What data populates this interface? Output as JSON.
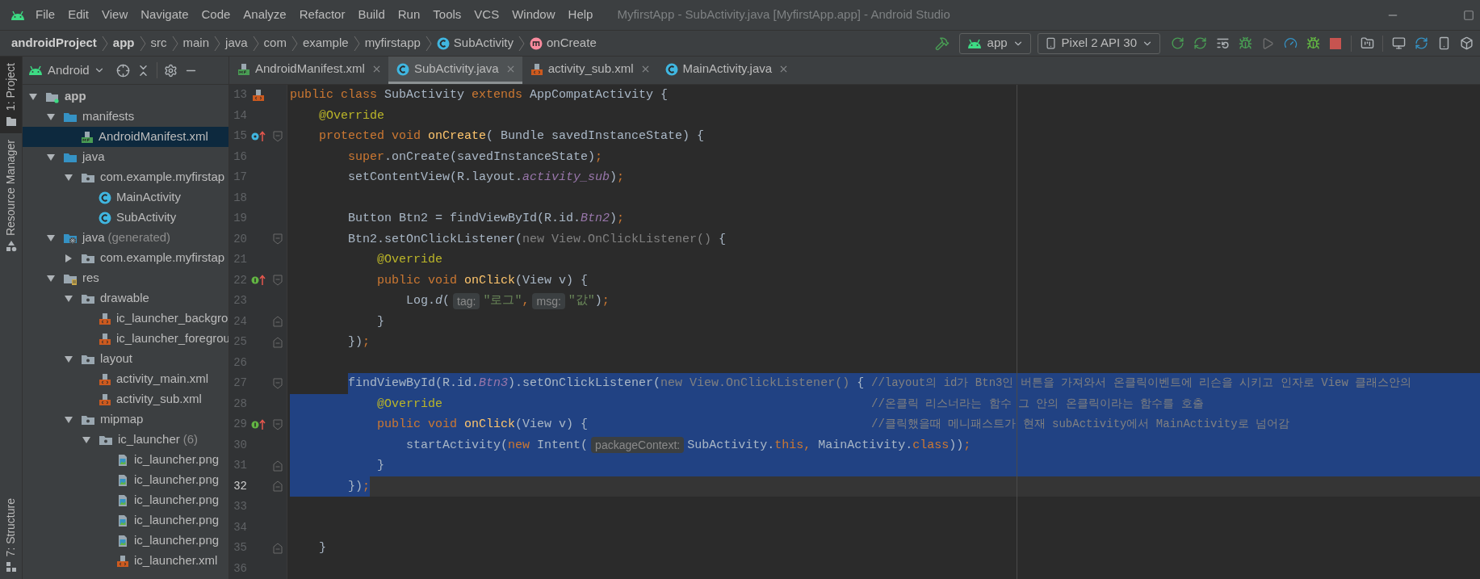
{
  "menu": {
    "items": [
      "File",
      "Edit",
      "View",
      "Navigate",
      "Code",
      "Analyze",
      "Refactor",
      "Build",
      "Run",
      "Tools",
      "VCS",
      "Window",
      "Help"
    ],
    "title": "MyfirstApp - SubActivity.java [MyfirstApp.app] - Android Studio"
  },
  "nav": {
    "breadcrumbs": [
      {
        "label": "androidProject",
        "kind": "project"
      },
      {
        "label": "app",
        "kind": "module"
      },
      {
        "label": "src",
        "kind": "folder"
      },
      {
        "label": "main",
        "kind": "folder"
      },
      {
        "label": "java",
        "kind": "folder"
      },
      {
        "label": "com",
        "kind": "folder"
      },
      {
        "label": "example",
        "kind": "folder"
      },
      {
        "label": "myfirstapp",
        "kind": "folder"
      },
      {
        "label": "SubActivity",
        "kind": "class"
      },
      {
        "label": "onCreate",
        "kind": "method"
      }
    ],
    "run_config": "app",
    "device": "Pixel 2 API 30"
  },
  "side_strip": [
    {
      "label": "1: Project",
      "selected": true
    },
    {
      "label": "Resource Manager",
      "selected": false
    },
    {
      "label": "7: Structure",
      "selected": false
    }
  ],
  "project_view": {
    "mode": "Android"
  },
  "tabs": [
    {
      "label": "AndroidManifest.xml",
      "kind": "manifest",
      "selected": false
    },
    {
      "label": "SubActivity.java",
      "kind": "class",
      "selected": true
    },
    {
      "label": "activity_sub.xml",
      "kind": "xml",
      "selected": false
    },
    {
      "label": "MainActivity.java",
      "kind": "class",
      "selected": false
    }
  ],
  "tree": [
    {
      "label": "app",
      "kind": "module",
      "expanded": true,
      "selected": false,
      "children": [
        {
          "label": "manifests",
          "kind": "folder",
          "expanded": true,
          "selected": false,
          "children": [
            {
              "label": "AndroidManifest.xml",
              "kind": "manifest",
              "selected": true
            }
          ]
        },
        {
          "label": "java",
          "kind": "folder",
          "expanded": true,
          "selected": false,
          "children": [
            {
              "label": "com.example.myfirstap",
              "kind": "package",
              "expanded": true,
              "selected": false,
              "children": [
                {
                  "label": "MainActivity",
                  "kind": "class",
                  "selected": false
                },
                {
                  "label": "SubActivity",
                  "kind": "class",
                  "selected": false
                }
              ]
            }
          ]
        },
        {
          "label": "java",
          "note": "(generated)",
          "kind": "generated",
          "expanded": true,
          "selected": false,
          "children": [
            {
              "label": "com.example.myfirstap",
              "kind": "package",
              "expanded": false,
              "selected": false
            }
          ]
        },
        {
          "label": "res",
          "kind": "res",
          "expanded": true,
          "selected": false,
          "children": [
            {
              "label": "drawable",
              "kind": "package",
              "expanded": true,
              "selected": false,
              "children": [
                {
                  "label": "ic_launcher_backgro",
                  "kind": "xml",
                  "selected": false
                },
                {
                  "label": "ic_launcher_foregrou",
                  "kind": "xml",
                  "selected": false
                }
              ]
            },
            {
              "label": "layout",
              "kind": "package",
              "expanded": true,
              "selected": false,
              "children": [
                {
                  "label": "activity_main.xml",
                  "kind": "xml",
                  "selected": false
                },
                {
                  "label": "activity_sub.xml",
                  "kind": "xml",
                  "selected": false
                }
              ]
            },
            {
              "label": "mipmap",
              "kind": "package",
              "expanded": true,
              "selected": false,
              "children": [
                {
                  "label": "ic_launcher",
                  "note": "(6)",
                  "kind": "package",
                  "expanded": true,
                  "selected": false,
                  "children": [
                    {
                      "label": "ic_launcher.png",
                      "kind": "png",
                      "selected": false
                    },
                    {
                      "label": "ic_launcher.png",
                      "kind": "png",
                      "selected": false
                    },
                    {
                      "label": "ic_launcher.png",
                      "kind": "png",
                      "selected": false
                    },
                    {
                      "label": "ic_launcher.png",
                      "kind": "png",
                      "selected": false
                    },
                    {
                      "label": "ic_launcher.png",
                      "kind": "png",
                      "selected": false
                    },
                    {
                      "label": "ic_launcher.xml",
                      "kind": "xml",
                      "selected": false
                    }
                  ]
                }
              ]
            }
          ]
        }
      ]
    }
  ],
  "editor": {
    "lines": [
      {
        "number": "13",
        "gutter_icons": [
          {
            "kind": "xml"
          }
        ],
        "selected": false,
        "current": false,
        "tokens": [
          {
            "t": "public class ",
            "kind": "kw"
          },
          {
            "t": "SubActivity ",
            "kind": "plain"
          },
          {
            "t": "extends ",
            "kind": "kw"
          },
          {
            "t": "AppCompatActivity {",
            "kind": "plain"
          }
        ]
      },
      {
        "number": "14",
        "selected": false,
        "current": false,
        "tokens": [
          {
            "t": "    @Override",
            "kind": "ann"
          }
        ]
      },
      {
        "number": "15",
        "gutter_icons": [
          {
            "kind": "override"
          },
          {
            "kind": "fold_start"
          }
        ],
        "selected": false,
        "current": false,
        "tokens": [
          {
            "t": "    protected void ",
            "kind": "kw"
          },
          {
            "t": "onCreate",
            "kind": "fn"
          },
          {
            "t": "( Bundle savedInstanceState) {",
            "kind": "plain"
          }
        ]
      },
      {
        "number": "16",
        "selected": false,
        "current": false,
        "tokens": [
          {
            "t": "        super",
            "kind": "kw"
          },
          {
            "t": ".onCreate(savedInstanceState)",
            "kind": "plain"
          },
          {
            "t": ";",
            "kind": "kw"
          }
        ]
      },
      {
        "number": "17",
        "selected": false,
        "current": false,
        "tokens": [
          {
            "t": "        setContentView(R.layout.",
            "kind": "plain"
          },
          {
            "t": "activity_sub",
            "kind": "field"
          },
          {
            "t": ")",
            "kind": "plain"
          },
          {
            "t": ";",
            "kind": "kw"
          }
        ]
      },
      {
        "number": "18",
        "selected": false,
        "current": false
      },
      {
        "number": "19",
        "selected": false,
        "current": false,
        "tokens": [
          {
            "t": "        Button Btn2 = findViewById(R.id.",
            "kind": "plain"
          },
          {
            "t": "Btn2",
            "kind": "field"
          },
          {
            "t": ")",
            "kind": "plain"
          },
          {
            "t": ";",
            "kind": "kw"
          }
        ]
      },
      {
        "number": "20",
        "gutter_icons": [
          {
            "kind": "fold_start"
          }
        ],
        "selected": false,
        "current": false,
        "tokens": [
          {
            "t": "        Btn2.setOnClickListener(",
            "kind": "plain"
          },
          {
            "t": "new View.OnClickListener()",
            "kind": "gray"
          },
          {
            "t": " {",
            "kind": "plain"
          }
        ]
      },
      {
        "number": "21",
        "selected": false,
        "current": false,
        "tokens": [
          {
            "t": "            @Override",
            "kind": "ann"
          }
        ]
      },
      {
        "number": "22",
        "gutter_icons": [
          {
            "kind": "implement"
          },
          {
            "kind": "fold_start"
          }
        ],
        "selected": false,
        "current": false,
        "tokens": [
          {
            "t": "            public void ",
            "kind": "kw"
          },
          {
            "t": "onClick",
            "kind": "fn"
          },
          {
            "t": "(View v) {",
            "kind": "plain"
          }
        ]
      },
      {
        "number": "23",
        "selected": false,
        "current": false,
        "tokens": [
          {
            "t": "                Log.",
            "kind": "plain"
          },
          {
            "t": "d",
            "kind": "italic"
          },
          {
            "t": "(",
            "kind": "plain"
          },
          {
            "t": "tag:",
            "kind": "hint"
          },
          {
            "t": "\"로그\"",
            "kind": "str"
          },
          {
            "t": ",",
            "kind": "kw"
          },
          {
            "t": "msg:",
            "kind": "hint"
          },
          {
            "t": "\"값\"",
            "kind": "str"
          },
          {
            "t": ")",
            "kind": "plain"
          },
          {
            "t": ";",
            "kind": "kw"
          }
        ]
      },
      {
        "number": "24",
        "gutter_icons": [
          {
            "kind": "fold_end"
          }
        ],
        "selected": false,
        "current": false,
        "tokens": [
          {
            "t": "            }",
            "kind": "plain"
          }
        ]
      },
      {
        "number": "25",
        "gutter_icons": [
          {
            "kind": "fold_end"
          }
        ],
        "selected": false,
        "current": false,
        "tokens": [
          {
            "t": "        })",
            "kind": "plain"
          },
          {
            "t": ";",
            "kind": "kw"
          }
        ]
      },
      {
        "number": "26",
        "selected": false,
        "current": false
      },
      {
        "number": "27",
        "gutter_icons": [
          {
            "kind": "fold_start"
          }
        ],
        "selected": true,
        "current": false,
        "tokens": [
          {
            "t": "        findViewById(R.id.",
            "kind": "plain"
          },
          {
            "t": "Btn3",
            "kind": "field"
          },
          {
            "t": ").setOnClickListener(",
            "kind": "plain"
          },
          {
            "t": "new View.OnClickListener()",
            "kind": "gray"
          },
          {
            "t": " {",
            "kind": "plain"
          }
        ],
        "comment": "//layout의 id가 Btn3인 버튼을 가져와서 온클릭이벤트에 리슨을 시키고 인자로 View 클래스안의"
      },
      {
        "number": "28",
        "selected": true,
        "current": false,
        "tokens": [
          {
            "t": "            @Override",
            "kind": "ann"
          }
        ],
        "comment": "//온클릭 리스너라는 함수 그 안의 온클릭이라는 함수를 호출"
      },
      {
        "number": "29",
        "gutter_icons": [
          {
            "kind": "implement"
          },
          {
            "kind": "fold_start"
          }
        ],
        "selected": true,
        "current": false,
        "tokens": [
          {
            "t": "            public void ",
            "kind": "kw"
          },
          {
            "t": "onClick",
            "kind": "fn"
          },
          {
            "t": "(View v) {",
            "kind": "plain"
          }
        ],
        "comment": "//클릭했을때 메니패스트가 현재 subActivity에서 MainActivity로 넘어감"
      },
      {
        "number": "30",
        "selected": true,
        "current": false,
        "tokens": [
          {
            "t": "                startActivity(",
            "kind": "plain"
          },
          {
            "t": "new ",
            "kind": "kw"
          },
          {
            "t": "Intent(",
            "kind": "plain"
          },
          {
            "t": "packageContext:",
            "kind": "hint"
          },
          {
            "t": "SubActivity.",
            "kind": "plain"
          },
          {
            "t": "this",
            "kind": "kw"
          },
          {
            "t": ",",
            "kind": "kw"
          },
          {
            "t": " MainActivity.",
            "kind": "plain"
          },
          {
            "t": "class",
            "kind": "kw"
          },
          {
            "t": "))",
            "kind": "plain"
          },
          {
            "t": ";",
            "kind": "kw"
          }
        ]
      },
      {
        "number": "31",
        "gutter_icons": [
          {
            "kind": "fold_end"
          }
        ],
        "selected": true,
        "current": false,
        "tokens": [
          {
            "t": "            }",
            "kind": "plain"
          }
        ]
      },
      {
        "number": "32",
        "gutter_icons": [
          {
            "kind": "fold_end"
          }
        ],
        "selected": true,
        "current": true,
        "tokens": [
          {
            "t": "        })",
            "kind": "plain"
          },
          {
            "t": ";",
            "kind": "kw"
          }
        ]
      },
      {
        "number": "33",
        "selected": false,
        "current": false
      },
      {
        "number": "34",
        "selected": false,
        "current": false
      },
      {
        "number": "35",
        "gutter_icons": [
          {
            "kind": "fold_end"
          }
        ],
        "selected": false,
        "current": false,
        "tokens": [
          {
            "t": "    }",
            "kind": "plain"
          }
        ]
      },
      {
        "number": "36",
        "selected": false,
        "current": false
      }
    ]
  }
}
